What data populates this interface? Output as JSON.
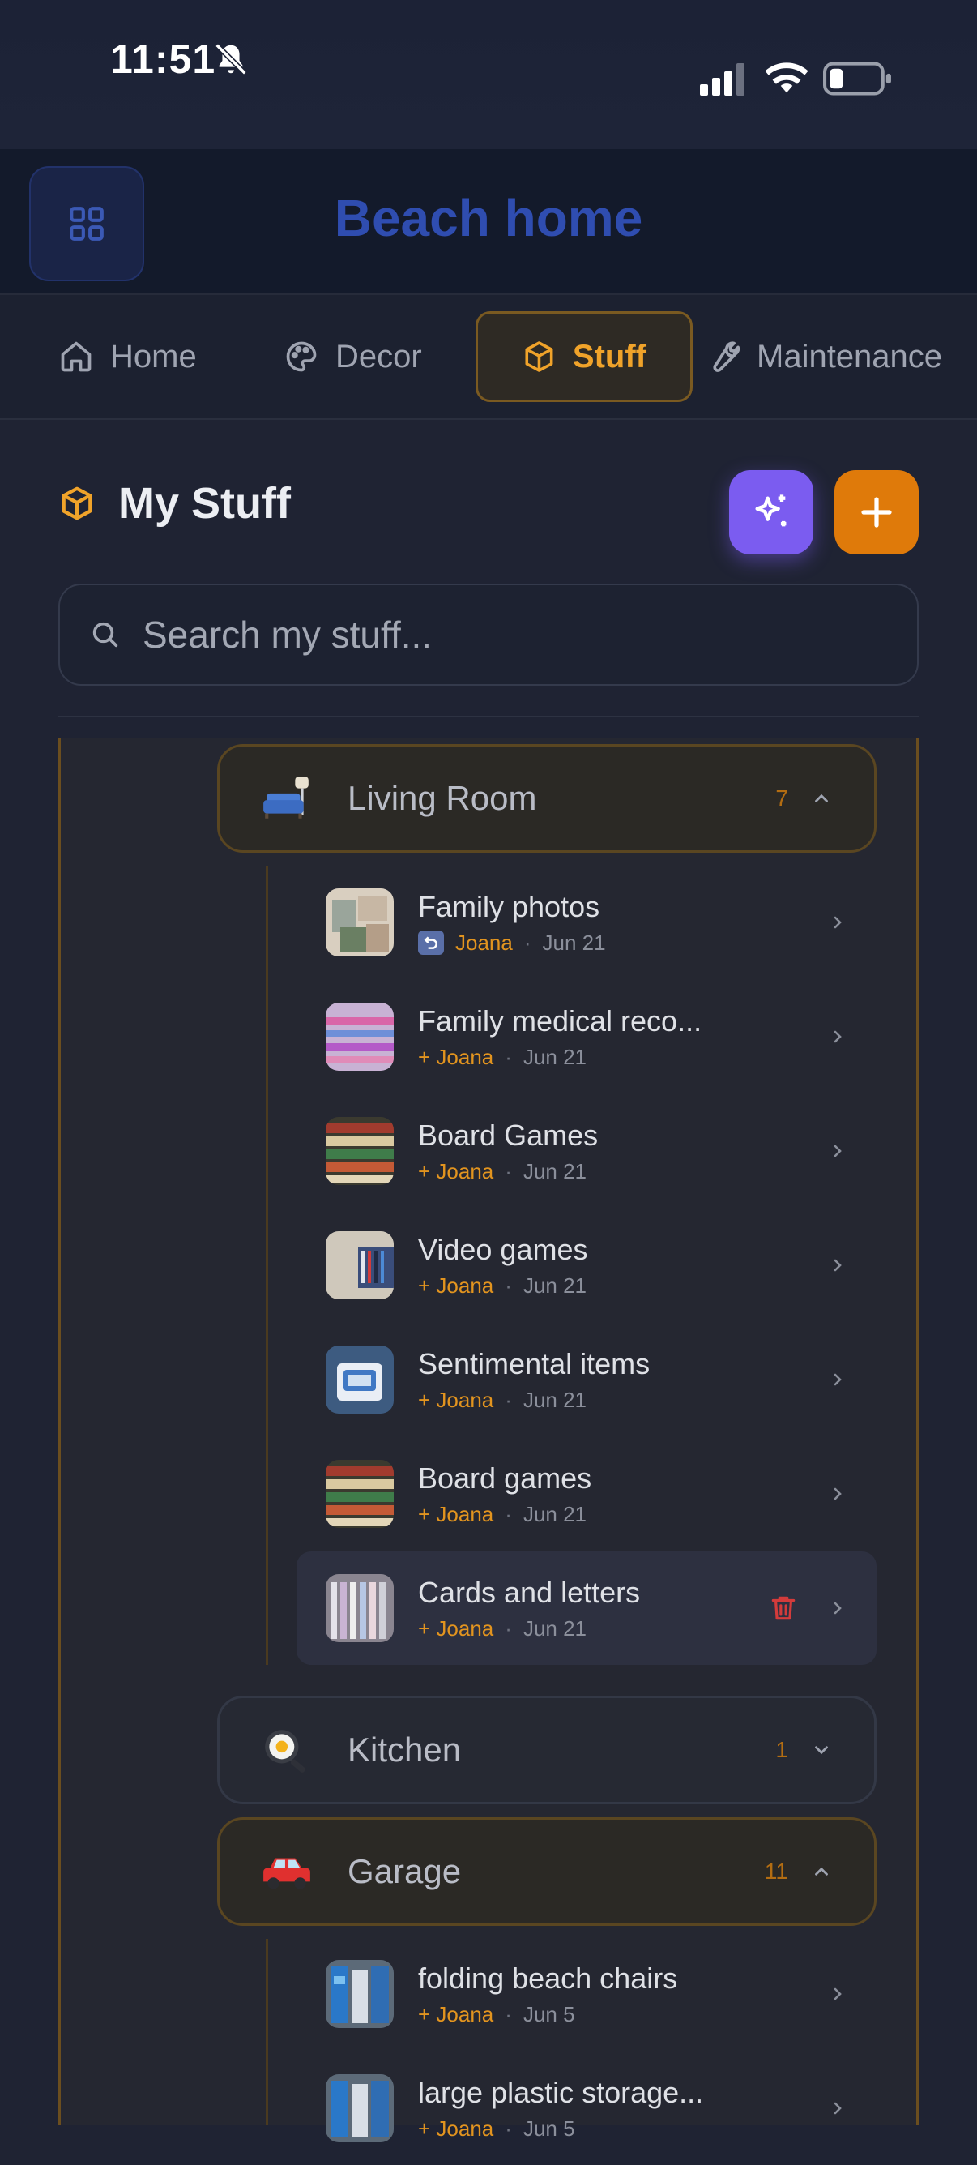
{
  "status_bar": {
    "time": "11:51"
  },
  "header": {
    "title": "Beach home"
  },
  "tabs": [
    {
      "label": "Home",
      "icon": "home-icon",
      "active": false
    },
    {
      "label": "Decor",
      "icon": "palette-icon",
      "active": false
    },
    {
      "label": "Stuff",
      "icon": "box-icon",
      "active": true
    },
    {
      "label": "Maintenance",
      "icon": "wrench-icon",
      "active": false
    }
  ],
  "section": {
    "title": "My Stuff"
  },
  "search": {
    "placeholder": "Search my stuff..."
  },
  "rooms": [
    {
      "name": "Living Room",
      "emoji": "couch-lamp",
      "count": "7",
      "expanded": true,
      "items": [
        {
          "name": "Family photos",
          "user": "Joana",
          "prefix": "",
          "date": "Jun 21",
          "restored": true
        },
        {
          "name": "Family medical reco...",
          "user": "Joana",
          "prefix": "+",
          "date": "Jun 21"
        },
        {
          "name": "Board Games",
          "user": "Joana",
          "prefix": "+",
          "date": "Jun 21"
        },
        {
          "name": "Video games",
          "user": "Joana",
          "prefix": "+",
          "date": "Jun 21"
        },
        {
          "name": "Sentimental items",
          "user": "Joana",
          "prefix": "+",
          "date": "Jun 21"
        },
        {
          "name": "Board games",
          "user": "Joana",
          "prefix": "+",
          "date": "Jun 21"
        },
        {
          "name": "Cards and letters",
          "user": "Joana",
          "prefix": "+",
          "date": "Jun 21",
          "selected": true
        }
      ]
    },
    {
      "name": "Kitchen",
      "emoji": "frying-pan",
      "count": "1",
      "expanded": false
    },
    {
      "name": "Garage",
      "emoji": "red-car",
      "count": "11",
      "expanded": true,
      "items": [
        {
          "name": "folding beach chairs",
          "user": "Joana",
          "prefix": "+",
          "date": "Jun 5"
        },
        {
          "name": "large plastic storage...",
          "user": "Joana",
          "prefix": "+",
          "date": "Jun 5"
        }
      ]
    }
  ],
  "colors": {
    "accent": "#f0a32a",
    "title_blue": "#2f4db0",
    "ai_purple": "#7b5cf0",
    "add_orange": "#df7a0a",
    "delete_red": "#d33b3b"
  }
}
